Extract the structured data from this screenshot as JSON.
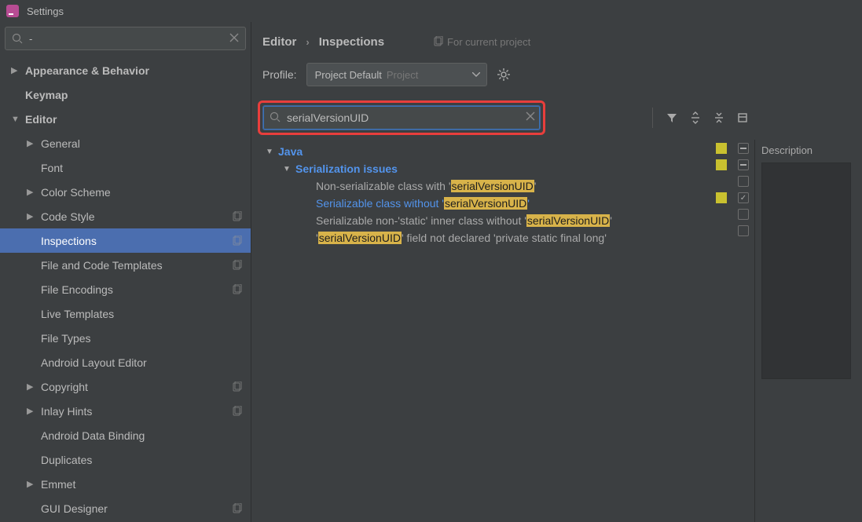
{
  "window": {
    "title": "Settings"
  },
  "sidebar": {
    "searchValue": "-",
    "items": [
      {
        "label": "Appearance & Behavior",
        "level": 0,
        "exp": "▶",
        "bold": true
      },
      {
        "label": "Keymap",
        "level": 0,
        "exp": "",
        "bold": true
      },
      {
        "label": "Editor",
        "level": 0,
        "exp": "▼",
        "bold": true
      },
      {
        "label": "General",
        "level": 1,
        "exp": "▶"
      },
      {
        "label": "Font",
        "level": 1,
        "exp": ""
      },
      {
        "label": "Color Scheme",
        "level": 1,
        "exp": "▶"
      },
      {
        "label": "Code Style",
        "level": 1,
        "exp": "▶",
        "scope": true
      },
      {
        "label": "Inspections",
        "level": 1,
        "exp": "",
        "selected": true,
        "scope": true
      },
      {
        "label": "File and Code Templates",
        "level": 1,
        "exp": "",
        "scope": true
      },
      {
        "label": "File Encodings",
        "level": 1,
        "exp": "",
        "scope": true
      },
      {
        "label": "Live Templates",
        "level": 1,
        "exp": ""
      },
      {
        "label": "File Types",
        "level": 1,
        "exp": ""
      },
      {
        "label": "Android Layout Editor",
        "level": 1,
        "exp": ""
      },
      {
        "label": "Copyright",
        "level": 1,
        "exp": "▶",
        "scope": true
      },
      {
        "label": "Inlay Hints",
        "level": 1,
        "exp": "▶",
        "scope": true
      },
      {
        "label": "Android Data Binding",
        "level": 1,
        "exp": ""
      },
      {
        "label": "Duplicates",
        "level": 1,
        "exp": ""
      },
      {
        "label": "Emmet",
        "level": 1,
        "exp": "▶"
      },
      {
        "label": "GUI Designer",
        "level": 1,
        "exp": "",
        "scope": true
      }
    ]
  },
  "breadcrumb": {
    "part1": "Editor",
    "part2": "Inspections",
    "note": "For current project"
  },
  "profile": {
    "label": "Profile:",
    "value": "Project Default",
    "sub": "Project"
  },
  "search": {
    "value": "serialVersionUID"
  },
  "tree": {
    "java": "Java",
    "serialization": "Serialization issues",
    "r0a": "Non-serializable class with '",
    "r0b": "serialVersionUID",
    "r0c": "'",
    "r1a": "Serializable class without '",
    "r1b": "serialVersionUID",
    "r1c": "'",
    "r2a": "Serializable non-'static' inner class without '",
    "r2b": "serialVersionUID",
    "r2c": "'",
    "r3a": "'",
    "r3b": "serialVersionUID",
    "r3c": "' field not declared 'private static final long'"
  },
  "desc": {
    "title": "Description"
  }
}
